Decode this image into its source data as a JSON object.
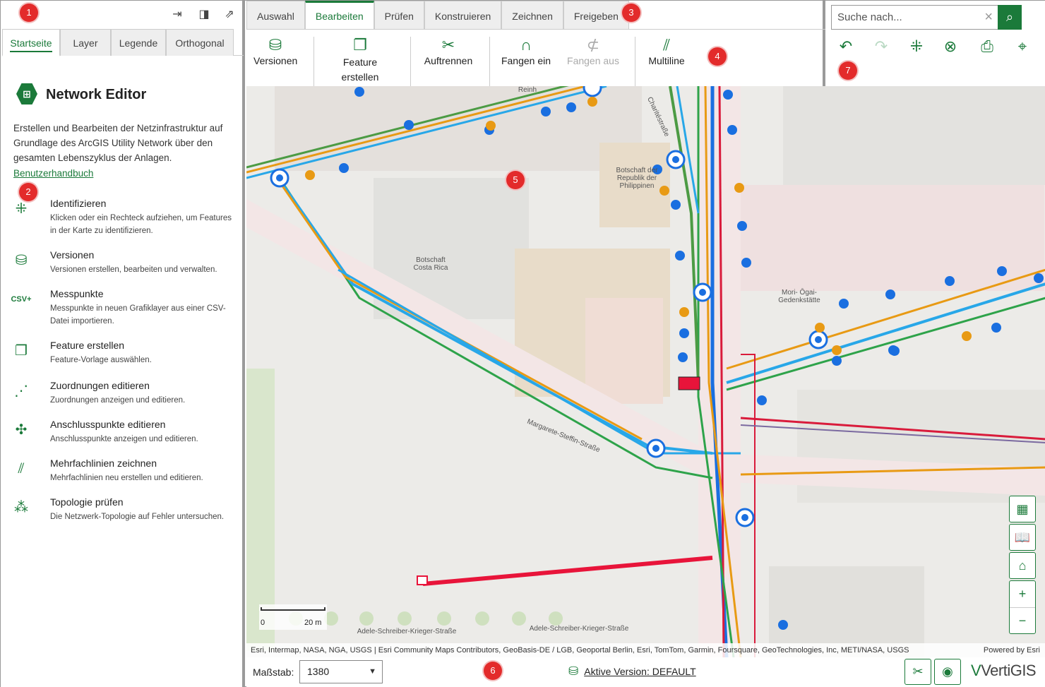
{
  "left_panel": {
    "tabs": [
      {
        "label": "Startseite",
        "active": true
      },
      {
        "label": "Layer",
        "active": false
      },
      {
        "label": "Legende",
        "active": false
      },
      {
        "label": "Orthogonal",
        "active": false
      }
    ],
    "title": "Network Editor",
    "description": "Erstellen und Bearbeiten der Netzinfrastruktur auf Grundlage des ArcGIS Utility Network über den gesamten Lebenszyklus der Anlagen.",
    "help_link": "Benutzerhandbuch",
    "tools": [
      {
        "name": "Identifizieren",
        "desc": "Klicken oder ein Rechteck aufziehen, um Features in der Karte zu identifizieren.",
        "icon": "identify-icon"
      },
      {
        "name": "Versionen",
        "desc": "Versionen erstellen, bearbeiten und verwalten.",
        "icon": "database-icon"
      },
      {
        "name": "Messpunkte",
        "desc": "Messpunkte in neuen Grafiklayer aus einer CSV-Datei importieren.",
        "icon": "csv-icon"
      },
      {
        "name": "Feature erstellen",
        "desc": "Feature-Vorlage auswählen.",
        "icon": "feature-create-icon"
      },
      {
        "name": "Zuordnungen editieren",
        "desc": "Zuordnungen anzeigen und editieren.",
        "icon": "association-icon"
      },
      {
        "name": "Anschlusspunkte editieren",
        "desc": "Anschlusspunkte anzeigen und editieren.",
        "icon": "connection-points-icon"
      },
      {
        "name": "Mehrfachlinien zeichnen",
        "desc": "Mehrfachlinien neu erstellen und editieren.",
        "icon": "multiline-icon"
      },
      {
        "name": "Topologie prüfen",
        "desc": "Die Netzwerk-Topologie auf Fehler untersuchen.",
        "icon": "topology-icon"
      }
    ]
  },
  "ribbon": {
    "tabs": [
      {
        "label": "Auswahl",
        "active": false
      },
      {
        "label": "Bearbeiten",
        "active": true
      },
      {
        "label": "Prüfen",
        "active": false
      },
      {
        "label": "Konstruieren",
        "active": false
      },
      {
        "label": "Zeichnen",
        "active": false
      },
      {
        "label": "Freigeben",
        "active": false
      }
    ],
    "buttons": {
      "versionen": "Versionen",
      "feature_line1": "Feature",
      "feature_line2": "erstellen",
      "auftrennen": "Auftrennen",
      "fangen_ein": "Fangen ein",
      "fangen_aus": "Fangen aus",
      "multiline": "Multiline"
    }
  },
  "search": {
    "placeholder": "Suche nach..."
  },
  "toolbar_icons": [
    "undo-icon",
    "redo-icon",
    "identify-icon",
    "clear-icon",
    "print-icon",
    "map-pin-icon"
  ],
  "map": {
    "labels": {
      "botschaft_phil": "Botschaft der Republik der Philippinen",
      "botschaft_cr": "Botschaft Costa Rica",
      "mori": "Mori- Ōgai- Gedenkstätte",
      "margarete": "Margarete-Steffin-Straße",
      "adele1": "Adele-Schreiber-Krieger-Straße",
      "adele2": "Adele-Schreiber-Krieger-Straße",
      "charite": "Charitéstraße",
      "reinhardt": "Reinh"
    },
    "scale_left": "0",
    "scale_right": "20 m",
    "attribution": "Esri, Intermap, NASA, NGA, USGS | Esri Community Maps Contributors, GeoBasis-DE / LGB, Geoportal Berlin, Esri, TomTom, Garmin, Foursquare, GeoTechnologies, Inc, METI/NASA, USGS",
    "powered_by": "Powered by Esri"
  },
  "footer": {
    "scale_label": "Maßstab:",
    "scale_value": "1380",
    "version_label": "Aktive Version: DEFAULT",
    "brand": "VertiGIS"
  },
  "badges": [
    "1",
    "2",
    "3",
    "4",
    "5",
    "6",
    "7"
  ],
  "colors": {
    "accent": "#1b7a3a",
    "badge": "#e32b2b"
  }
}
